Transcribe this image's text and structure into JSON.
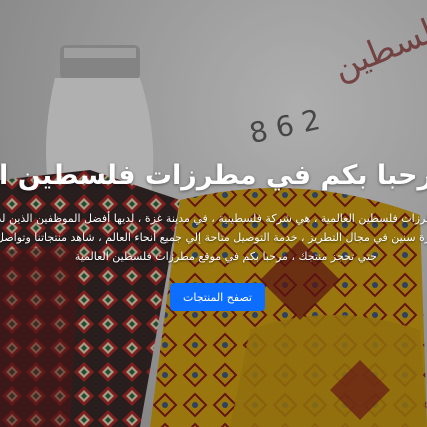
{
  "hero": {
    "title": "مرحبا بكم في مطرزات فلسطين العالمية",
    "description_lines": [
      "مطرزات فلسطين العالمية ، هي شركة فلسطينية ، في مدينة غزة ، لديها أفضل الموظفين الذين لديهم",
      "خبرة سنين في مجال التطريز ، خدمة التوصيل متاحة إلي جميع أنحاء العالم ، شاهد منتجاتنا وتواصل معنا",
      "حتي تحجز منتجك ، مرحبا بكم في موقع مطرزات فلسطين العالمية"
    ],
    "cta_label": "تصفح المنتجات",
    "background": {
      "sign_text": "مطرزات فلسطين",
      "sign_numbers": "8 6 2"
    }
  }
}
